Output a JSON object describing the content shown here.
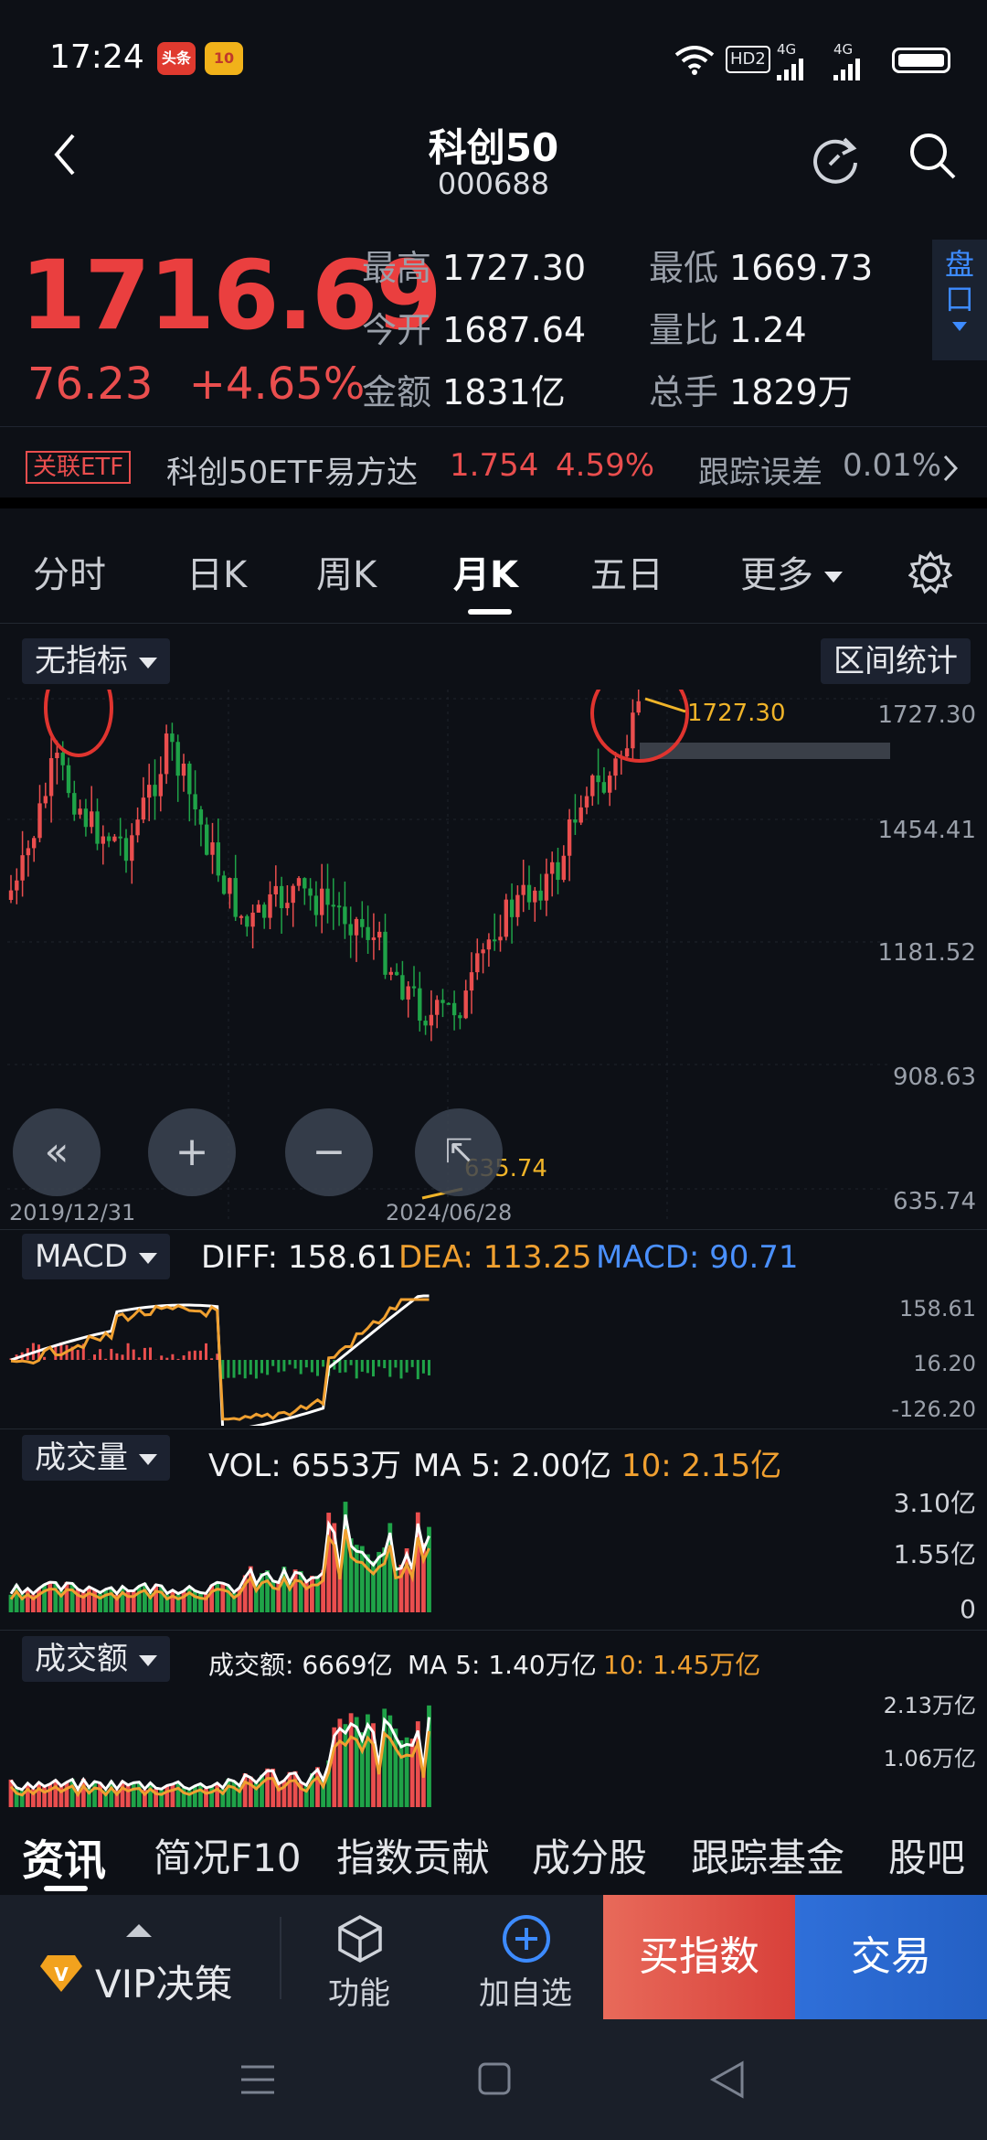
{
  "status_bar": {
    "time": "17:24",
    "app_badge_1": "头条",
    "app_badge_2": "10",
    "network": "HD2",
    "signal_1": "4G",
    "signal_2": "4G"
  },
  "header": {
    "title": "科创50",
    "code": "000688"
  },
  "quote": {
    "price": "1716.69",
    "change": "76.23",
    "change_pct": "+4.65%",
    "stats": {
      "high_label": "最高",
      "high": "1727.30",
      "low_label": "最低",
      "low": "1669.73",
      "open_label": "今开",
      "open": "1687.64",
      "ratio_label": "量比",
      "ratio": "1.24",
      "amount_label": "金额",
      "amount": "1831亿",
      "hands_label": "总手",
      "hands": "1829万"
    },
    "pankou": [
      "盘",
      "口"
    ]
  },
  "etf_bar": {
    "tag": "关联ETF",
    "name": "科创50ETF易方达",
    "price": "1.754",
    "pct": "4.59%",
    "tracking_label": "跟踪误差",
    "tracking_value": "0.01%"
  },
  "period_tabs": [
    "分时",
    "日K",
    "周K",
    "月K",
    "五日",
    "更多"
  ],
  "active_tab": "月K",
  "chart": {
    "indicator_select": "无指标",
    "range_stats_button": "区间统计",
    "y_ticks": [
      "1727.30",
      "1454.41",
      "1181.52",
      "908.63",
      "635.74"
    ],
    "x_labels": [
      "2019/12/31",
      "2024/06/28"
    ],
    "max_label": "1727.30",
    "min_label": "635.74"
  },
  "macd": {
    "select": "MACD",
    "diff": "DIFF: 158.61",
    "dea": "DEA: 113.25",
    "macd": "MACD: 90.71",
    "ticks": [
      "158.61",
      "16.20",
      "-126.20"
    ]
  },
  "volume": {
    "select": "成交量",
    "vol": "VOL: 6553万",
    "ma5": "MA 5: 2.00亿",
    "ma10": "10: 2.15亿",
    "ticks": [
      "3.10亿",
      "1.55亿",
      "0"
    ]
  },
  "amount": {
    "select": "成交额",
    "amt": "成交额: 6669亿",
    "ma5": "MA 5: 1.40万亿",
    "ma10": "10: 1.45万亿",
    "ticks": [
      "2.13万亿",
      "1.06万亿"
    ]
  },
  "sub_tabs": [
    "资讯",
    "简况F10",
    "指数贡献",
    "成分股",
    "跟踪基金",
    "股吧"
  ],
  "bottom_bar": {
    "vip": "VIP决策",
    "func": "功能",
    "watch": "加自选",
    "buy": "买指数",
    "trade": "交易"
  },
  "colors": {
    "up": "#ea4e4e",
    "down": "#1fa348",
    "accent_blue": "#3d8bff",
    "dea_orange": "#f0a030",
    "buy_red": "#e24a43",
    "trade_blue": "#2d6fd8"
  }
}
